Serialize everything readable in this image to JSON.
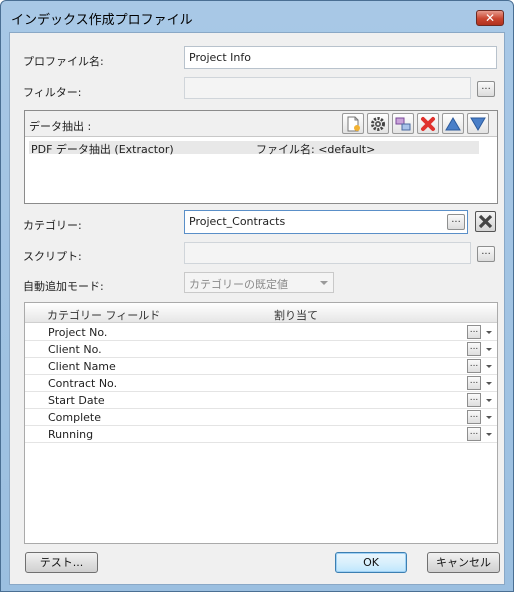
{
  "window": {
    "title": "インデックス作成プロファイル",
    "close_label": "✕"
  },
  "profile": {
    "label": "プロファイル名:",
    "value": "Project Info"
  },
  "filter": {
    "label": "フィルター:",
    "value": "",
    "button": "..."
  },
  "extraction": {
    "label": "データ抽出 :",
    "toolbar": [
      "new-icon",
      "gear-icon",
      "move-icon",
      "delete-icon",
      "up-arrow-icon",
      "down-arrow-icon"
    ],
    "rows": [
      {
        "name": "PDF データ抽出 (Extractor)",
        "file": "ファイル名: <default>"
      }
    ]
  },
  "category": {
    "label": "カテゴリー:",
    "value": "Project_Contracts",
    "button": "..."
  },
  "script": {
    "label": "スクリプト:",
    "value": "",
    "button": "..."
  },
  "auto_add": {
    "label": "自動追加モード:",
    "selected": "カテゴリーの既定値"
  },
  "grid": {
    "headers": [
      "カテゴリー フィールド",
      "割り当て"
    ],
    "rows": [
      "Project No.",
      "Client No.",
      "Client Name",
      "Contract No.",
      "Start Date",
      "Complete",
      "Running"
    ],
    "row_button": "..."
  },
  "buttons": {
    "test": "テスト...",
    "ok": "OK",
    "cancel": "キャンセル"
  },
  "colors": {
    "titlebar": "#a8c8e6",
    "close": "#c9452f",
    "delete": "#e0312d",
    "arrow": "#4a7fc8"
  }
}
